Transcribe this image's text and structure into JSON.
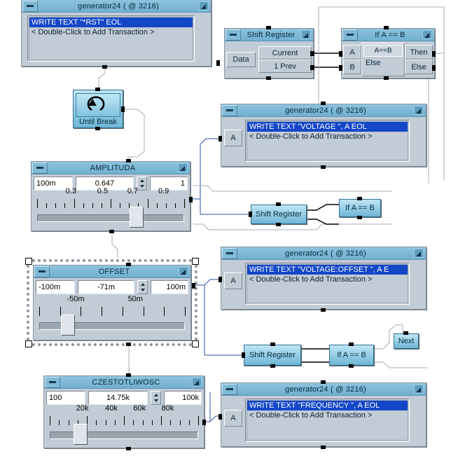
{
  "app": {
    "background": "#ffffff",
    "accent_titlebar": "#7fbcd8",
    "panel_face": "#c2ccd6",
    "selection_blue": "#1447c8"
  },
  "transaction_placeholder": "< Double-Click to Add Transaction >",
  "generators": [
    {
      "id": "gen-rst",
      "title": "generator24 ( @ 3216)",
      "selected_line": "WRITE TEXT \"*RST\" EOL",
      "placeholder_line": "< Double-Click to Add Transaction >",
      "port": ""
    },
    {
      "id": "gen-voltage",
      "title": "generator24 ( @ 3216)",
      "selected_line": "WRITE TEXT \"VOLTAGE \", A EOL",
      "placeholder_line": "< Double-Click to Add Transaction >",
      "port": "A"
    },
    {
      "id": "gen-offset",
      "title": "generator24 ( @ 3216)",
      "selected_line": "WRITE TEXT \"VOLTAGE:OFFSET \", A E",
      "placeholder_line": "< Double-Click to Add Transaction >",
      "port": "A"
    },
    {
      "id": "gen-frequency",
      "title": "generator24 ( @ 3216)",
      "selected_line": "WRITE TEXT \"FREQUENCY \", A EOL",
      "placeholder_line": "< Double-Click to Add Transaction >",
      "port": "A"
    }
  ],
  "loop_node": {
    "label": "Until Break",
    "icon": "loop-arrow-icon"
  },
  "shift_register_expanded": {
    "title": "Shift Register",
    "input_label": "Data",
    "outputs": [
      "Current",
      "1 Prev"
    ]
  },
  "if_block_expanded": {
    "title": "If A == B",
    "inputs": [
      "A",
      "B"
    ],
    "conditions": [
      "A==B",
      "Else"
    ],
    "outputs": [
      "Then",
      "Else"
    ]
  },
  "collapsed_nodes": [
    {
      "id": "sr2",
      "label": "Shift Register"
    },
    {
      "id": "if2",
      "label": "If A == B"
    },
    {
      "id": "sr3",
      "label": "Shift Register"
    },
    {
      "id": "if3",
      "label": "If A == B"
    },
    {
      "id": "next",
      "label": "Next"
    }
  ],
  "sliders": [
    {
      "id": "amplituda",
      "title": "AMPLITUDA",
      "min_field": "100m",
      "value_field": "0.647",
      "max_field": "1",
      "tick_labels": [
        "0.3",
        "0.5",
        "0.7",
        "0.9"
      ],
      "tick_label_pct": [
        23,
        44.5,
        65,
        86
      ],
      "thumb_pct": 63,
      "tick_count": 17,
      "major_every": 4,
      "selected": false
    },
    {
      "id": "offset",
      "title": "OFFSET",
      "min_field": "-100m",
      "value_field": "-71m",
      "max_field": "100m",
      "tick_labels": [
        "-50m",
        "50m"
      ],
      "tick_label_pct": [
        25,
        66
      ],
      "thumb_pct": 15,
      "tick_count": 8,
      "major_every": 1,
      "selected": true
    },
    {
      "id": "czestotliwosc",
      "title": "CZESTOTLIWOSC",
      "min_field": "100",
      "value_field": "14.75k",
      "max_field": "100k",
      "tick_labels": [
        "20k",
        "40k",
        "60k",
        "80k"
      ],
      "tick_label_pct": [
        22,
        41.5,
        60.5,
        79.5
      ],
      "thumb_pct": 16,
      "tick_count": 17,
      "major_every": 4,
      "selected": false
    }
  ]
}
